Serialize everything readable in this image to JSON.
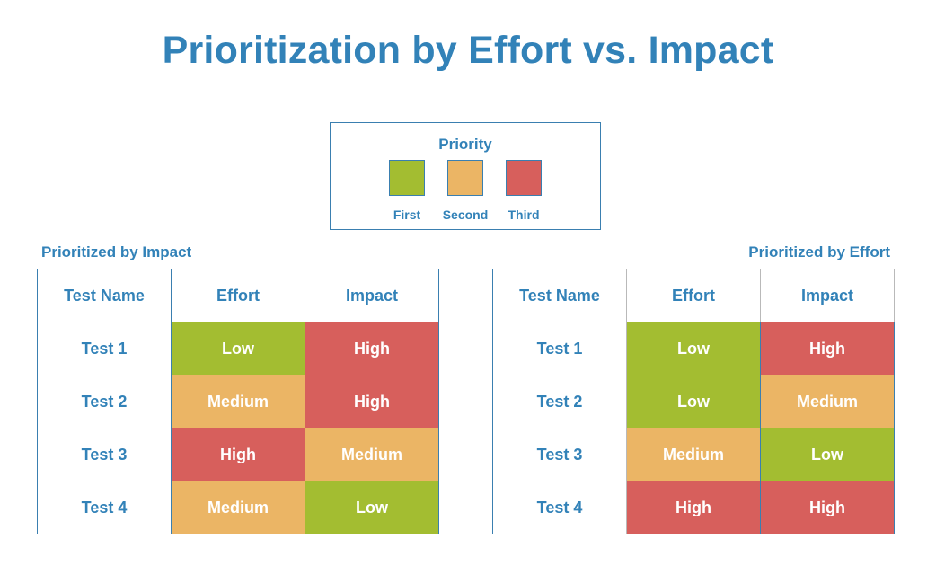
{
  "title": "Prioritization by Effort vs. Impact",
  "legend": {
    "title": "Priority",
    "items": [
      {
        "label": "First",
        "color": "#a3bd31"
      },
      {
        "label": "Second",
        "color": "#ebb565"
      },
      {
        "label": "Third",
        "color": "#d75f5c"
      }
    ]
  },
  "colors": {
    "Low": "#a3bd31",
    "Medium": "#ebb565",
    "High": "#d75f5c",
    "text": "#3282b8",
    "border": "#3a7fb0"
  },
  "tables": [
    {
      "caption": "Prioritized by Impact",
      "headers": [
        "Test Name",
        "Effort",
        "Impact"
      ],
      "rows": [
        {
          "name": "Test 1",
          "effort": "Low",
          "impact": "High",
          "effort_priority": "First",
          "impact_priority": "First"
        },
        {
          "name": "Test 2",
          "effort": "Medium",
          "impact": "High",
          "effort_priority": "Second",
          "impact_priority": "First"
        },
        {
          "name": "Test 3",
          "effort": "High",
          "impact": "Medium",
          "effort_priority": "Third",
          "impact_priority": "Second"
        },
        {
          "name": "Test 4",
          "effort": "Medium",
          "impact": "Low",
          "effort_priority": "Second",
          "impact_priority": "Third"
        }
      ]
    },
    {
      "caption": "Prioritized by Effort",
      "headers": [
        "Test Name",
        "Effort",
        "Impact"
      ],
      "rows": [
        {
          "name": "Test 1",
          "effort": "Low",
          "impact": "High",
          "effort_priority": "First",
          "impact_priority": "First"
        },
        {
          "name": "Test 2",
          "effort": "Low",
          "impact": "Medium",
          "effort_priority": "First",
          "impact_priority": "Second"
        },
        {
          "name": "Test 3",
          "effort": "Medium",
          "impact": "Low",
          "effort_priority": "Second",
          "impact_priority": "Third"
        },
        {
          "name": "Test 4",
          "effort": "High",
          "impact": "High",
          "effort_priority": "Third",
          "impact_priority": "First"
        }
      ]
    }
  ]
}
